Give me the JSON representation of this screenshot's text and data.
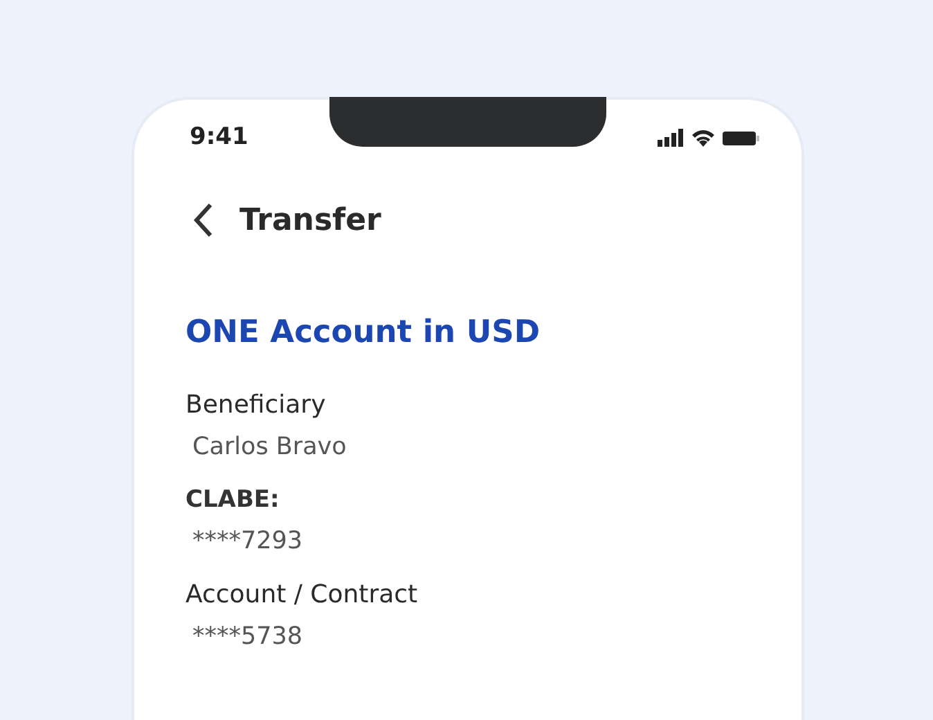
{
  "status_bar": {
    "time": "9:41"
  },
  "header": {
    "title": "Transfer"
  },
  "account_title": "ONE Account in USD",
  "fields": [
    {
      "label": "Beneficiary",
      "value": "Carlos Bravo",
      "kind": "normal"
    },
    {
      "label": "CLABE:",
      "value": "****7293",
      "kind": "bold"
    },
    {
      "label": "Account / Contract",
      "value": "****5738",
      "kind": "normal"
    }
  ]
}
